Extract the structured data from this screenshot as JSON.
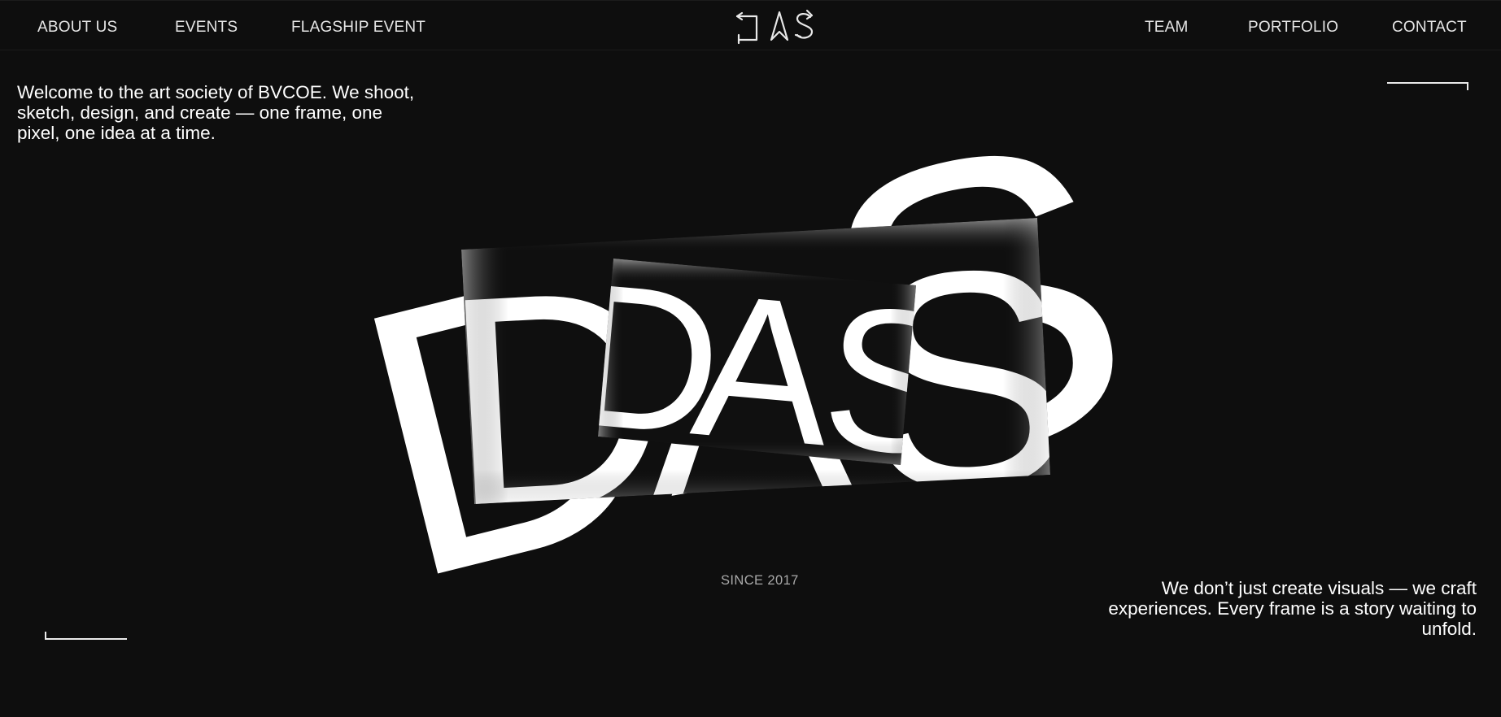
{
  "nav": {
    "left": [
      "ABOUT US",
      "EVENTS",
      "FLAGSHIP EVENT"
    ],
    "right": [
      "TEAM",
      "PORTFOLIO",
      "CONTACT"
    ],
    "logo_icon": "das-logo-icon"
  },
  "intro": "Welcome to the art society of BVCOE. We shoot, sketch, design, and create — one frame, one pixel, one idea at a time.",
  "hero": {
    "word": "DAS",
    "letters": [
      "D",
      "A",
      "S"
    ]
  },
  "since": "SINCE 2017",
  "outro": "We don’t just create visuals — we craft experiences. Every frame is a story waiting to unfold.",
  "colors": {
    "background": "#0e0e0e",
    "text": "#ffffff",
    "muted": "#a9a9a9"
  }
}
